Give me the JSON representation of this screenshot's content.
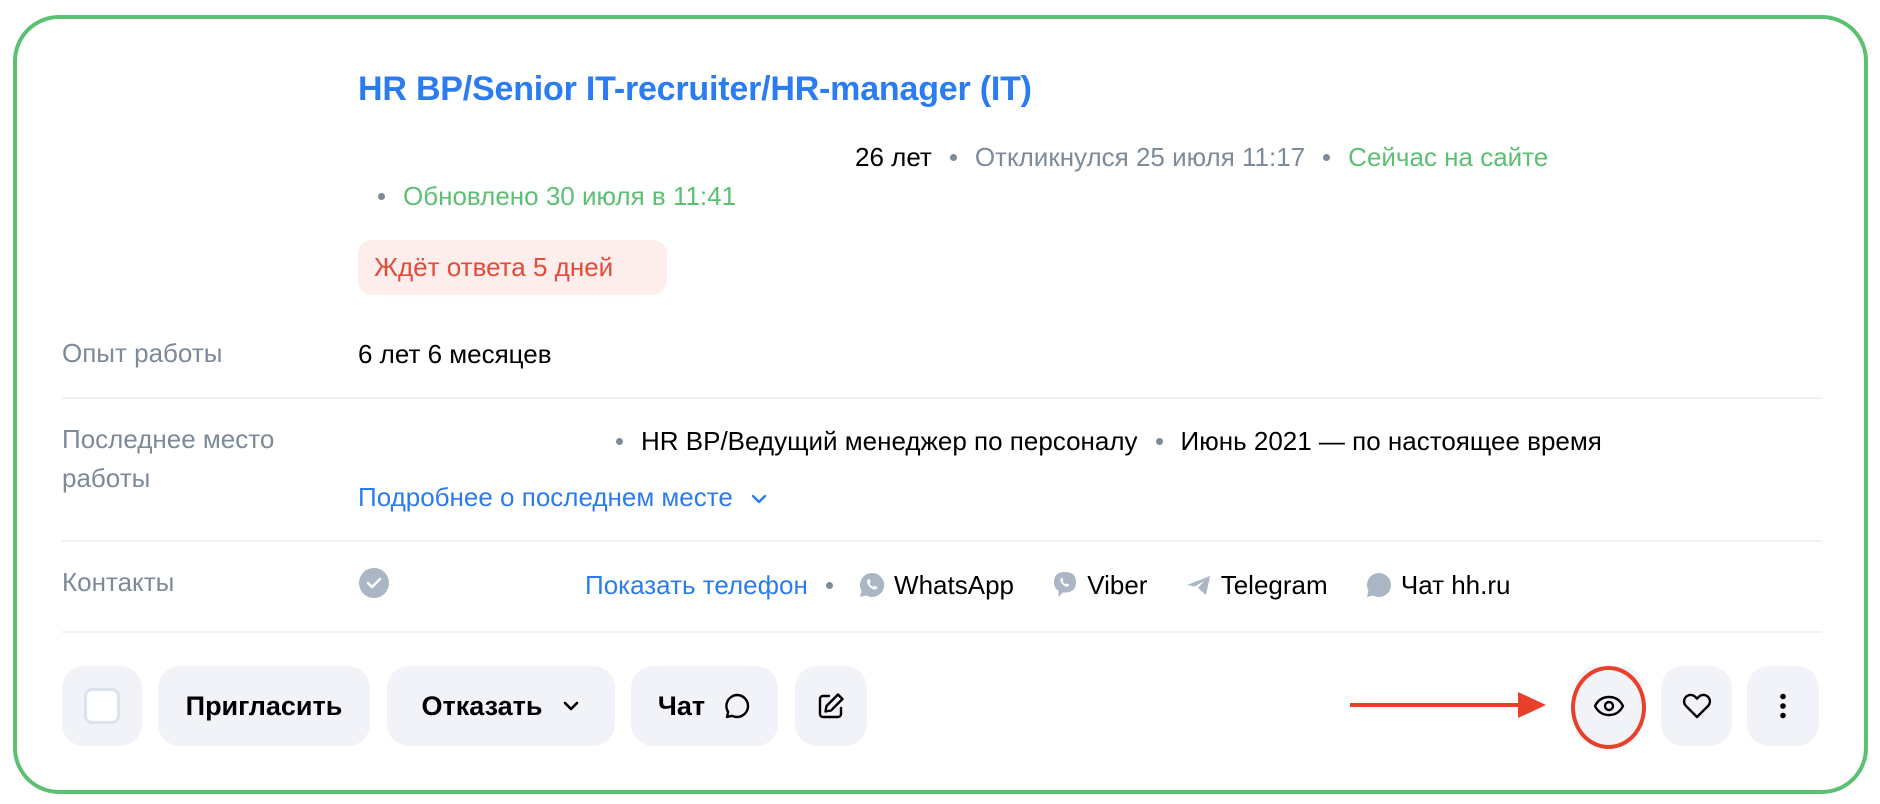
{
  "resume": {
    "title": "HR BP/Senior IT-recruiter/HR-manager (IT)",
    "age": "26 лет",
    "responded": "Откликнулся 25 июля 11:17",
    "online_status": "Сейчас на сайте",
    "updated": "Обновлено 30 июля в 11:41",
    "waiting_badge": "Ждёт ответа 5 дней"
  },
  "details": {
    "experience": {
      "label": "Опыт работы",
      "value": "6 лет 6 месяцев"
    },
    "last_job": {
      "label_line1": "Последнее место",
      "label_line2": "работы",
      "position": "HR BP/Ведущий менеджер по персоналу",
      "period": "Июнь 2021 — по настоящее время",
      "more_link": "Подробнее о последнем месте"
    },
    "contacts": {
      "label": "Контакты",
      "show_phone": "Показать телефон",
      "items": [
        {
          "icon": "whatsapp-icon",
          "label": "WhatsApp"
        },
        {
          "icon": "viber-icon",
          "label": "Viber"
        },
        {
          "icon": "telegram-icon",
          "label": "Telegram"
        },
        {
          "icon": "chat-bubble-icon",
          "label": "Чат hh.ru"
        }
      ]
    }
  },
  "actions": {
    "invite": "Пригласить",
    "reject": "Отказать",
    "chat": "Чат",
    "icons": [
      "checkbox",
      "chevron-down-icon",
      "chat-icon",
      "edit-icon",
      "eye-icon",
      "heart-icon",
      "more-vertical-icon"
    ]
  },
  "colors": {
    "accent_blue": "#2b7cf0",
    "success_green": "#5cc072",
    "danger_red": "#e34a3a",
    "annotation_red": "#e8402a"
  }
}
